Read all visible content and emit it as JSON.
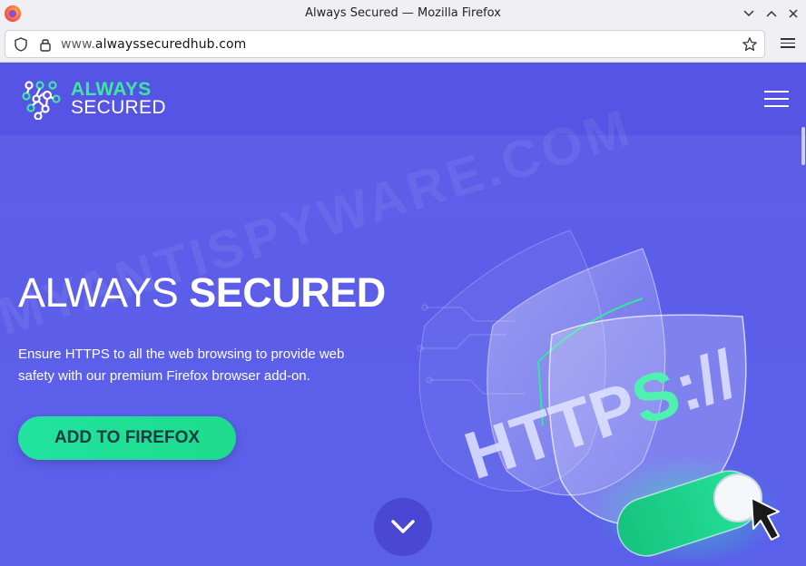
{
  "window": {
    "title": "Always Secured — Mozilla Firefox"
  },
  "urlbar": {
    "url_prefix": "www.",
    "url_domain": "alwayssecuredhub.com"
  },
  "site": {
    "logo_line1": "ALWAYS",
    "logo_line2": "SECURED",
    "hero_title_light": "ALWAYS ",
    "hero_title_bold": "SECURED",
    "hero_desc": "Ensure HTTPS to all the web browsing to provide web safety with our premium Firefox browser add-on.",
    "cta_label": "ADD TO FIREFOX",
    "illustration_text": "HTTPS://"
  },
  "watermark": "MYANTISPYWARE.COM",
  "colors": {
    "accent_green": "#22e3a0",
    "page_bg": "#5c5ee9",
    "button_text": "#163a44"
  },
  "icons": [
    "firefox-logo",
    "chevron-down-icon",
    "chevron-up-icon",
    "close-icon",
    "shield-icon",
    "lock-icon",
    "star-icon",
    "menu-icon",
    "hamburger-icon",
    "arrow-down-icon",
    "cursor-icon"
  ]
}
